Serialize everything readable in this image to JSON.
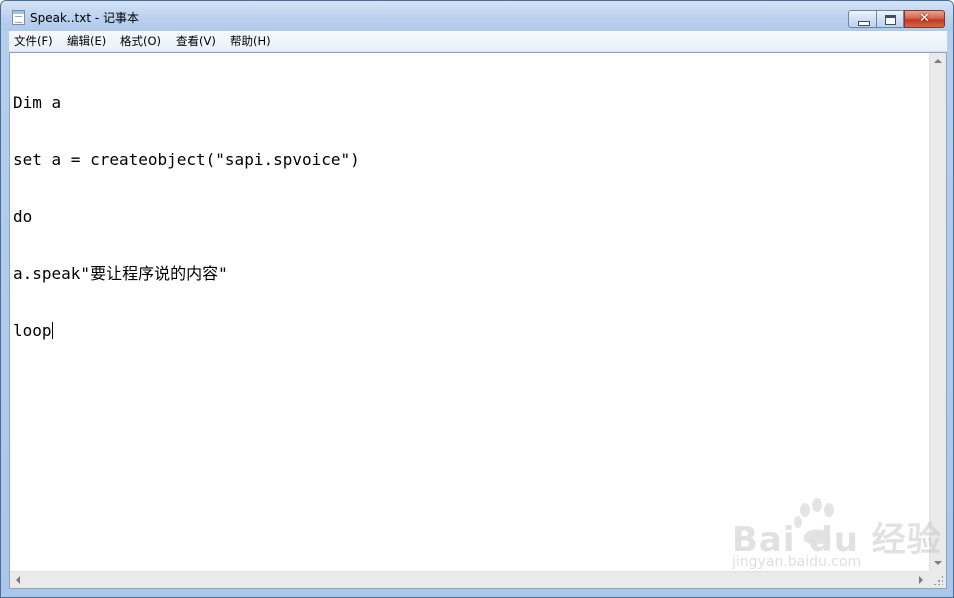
{
  "window": {
    "title": "Speak..txt - 记事本",
    "controls": {
      "minimize_icon": "minimize-icon",
      "maximize_icon": "maximize-icon",
      "close_symbol": "✕"
    }
  },
  "menubar": {
    "items": [
      {
        "label": "文件(F)"
      },
      {
        "label": "编辑(E)"
      },
      {
        "label": "格式(O)"
      },
      {
        "label": "查看(V)"
      },
      {
        "label": "帮助(H)"
      }
    ]
  },
  "editor": {
    "lines": [
      "Dim a",
      "set a = createobject(\"sapi.spvoice\")",
      "do",
      "a.speak\"要让程序说的内容\"",
      "loop"
    ]
  },
  "watermark": {
    "logo_text": "Bai  du 经验",
    "url": "jingyan.baidu.com"
  },
  "colors": {
    "titlebar": "#bdd3ef",
    "close_button": "#c1391f",
    "editor_background": "#ffffff",
    "frame_border": "#4a6c95"
  }
}
